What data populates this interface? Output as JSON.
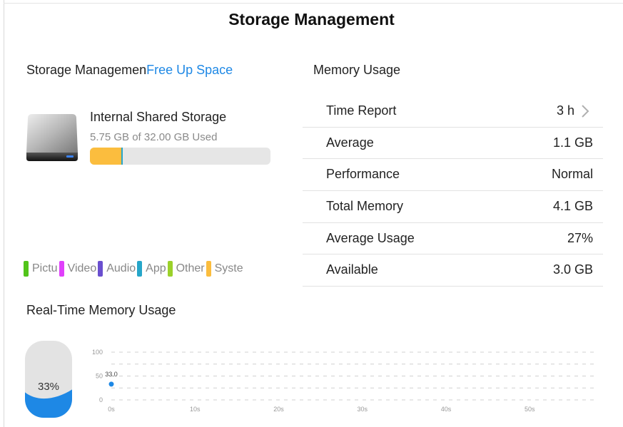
{
  "page": {
    "title": "Storage Management"
  },
  "storage": {
    "header_label": "Storage Managemen",
    "free_up_link": "Free Up Space",
    "device_name": "Internal Shared Storage",
    "usage_text": "5.75 GB of 32.00 GB Used",
    "used_gb": 5.75,
    "total_gb": 32.0,
    "segments": [
      {
        "name": "Syste",
        "fraction": 0.175,
        "color": "#fbbd3e"
      },
      {
        "name": "App",
        "fraction": 0.006,
        "color": "#26a6c9"
      }
    ],
    "legend": [
      {
        "label": "Pictu",
        "color": "#52c41a"
      },
      {
        "label": "Video",
        "color": "#e040fb"
      },
      {
        "label": "Audio",
        "color": "#6a4fcf"
      },
      {
        "label": "App",
        "color": "#26a6c9"
      },
      {
        "label": "Other",
        "color": "#9bd12a"
      },
      {
        "label": "Syste",
        "color": "#fbbd3e"
      }
    ]
  },
  "memory": {
    "header": "Memory Usage",
    "rows": [
      {
        "label": "Time Report",
        "value": "3 h"
      },
      {
        "label": "Average",
        "value": "1.1 GB"
      },
      {
        "label": "Performance",
        "value": "Normal"
      },
      {
        "label": "Total Memory",
        "value": "4.1 GB"
      },
      {
        "label": "Average Usage",
        "value": "27%"
      },
      {
        "label": "Available",
        "value": "3.0 GB"
      }
    ]
  },
  "realtime": {
    "header": "Real-Time Memory Usage",
    "gauge_text": "33%",
    "gauge_fraction": 0.33,
    "accent_color": "#1e88e5"
  },
  "chart_data": {
    "type": "scatter",
    "x": [
      0
    ],
    "y": [
      33.0
    ],
    "point_labels": [
      "33.0"
    ],
    "xticks": [
      "0s",
      "10s",
      "20s",
      "30s",
      "40s",
      "50s"
    ],
    "yticks": [
      "100",
      "50",
      "0"
    ],
    "xlim": [
      0,
      58
    ],
    "ylim": [
      0,
      100
    ],
    "grid": true
  }
}
